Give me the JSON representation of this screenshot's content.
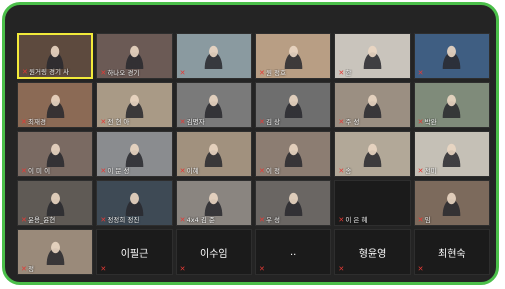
{
  "participants": [
    {
      "name": "원거링 경기 사",
      "video": true,
      "active": true,
      "bg": "#5d4a3e"
    },
    {
      "name": "하나오 경기",
      "video": true,
      "bg": "#6b5a55"
    },
    {
      "name": "",
      "video": true,
      "bg": "#8a9aa0"
    },
    {
      "name": "원 정호",
      "video": true,
      "bg": "#b89e84"
    },
    {
      "name": "한 ",
      "video": true,
      "bg": "#c9c4bc"
    },
    {
      "name": "",
      "video": true,
      "bg": "#3f5e82"
    },
    {
      "name": "최재경",
      "video": true,
      "bg": "#8b6a55"
    },
    {
      "name": "전 현 아",
      "video": true,
      "bg": "#a99a86"
    },
    {
      "name": "김명자",
      "video": true,
      "bg": "#7a7a7a"
    },
    {
      "name": "김 상 ",
      "video": true,
      "bg": "#6e6e6e"
    },
    {
      "name": "주 성",
      "video": true,
      "bg": "#9b8f82"
    },
    {
      "name": "박완 ",
      "video": true,
      "bg": "#7f8b7a"
    },
    {
      "name": "이 미 이",
      "video": true,
      "bg": "#7a6a62"
    },
    {
      "name": "이 문 성",
      "video": true,
      "bg": "#8a8c8f"
    },
    {
      "name": "이혜 ",
      "video": true,
      "bg": "#a1917e"
    },
    {
      "name": "이 정",
      "video": true,
      "bg": "#8c7d72"
    },
    {
      "name": "송 ",
      "video": true,
      "bg": "#b2a898"
    },
    {
      "name": "전미",
      "video": true,
      "bg": "#c5c0b6"
    },
    {
      "name": "윤용_윤현",
      "video": true,
      "bg": "#5f5a55"
    },
    {
      "name": "정정희 정진",
      "video": true,
      "bg": "#3e4a55"
    },
    {
      "name": "4x4 김 준",
      "video": true,
      "bg": "#8a8580"
    },
    {
      "name": "우 성 ",
      "video": true,
      "bg": "#6a6663"
    },
    {
      "name": "이 은 혜",
      "video": false,
      "bg": "#242424"
    },
    {
      "name": "임 ",
      "video": true,
      "bg": "#7c6a5c"
    },
    {
      "name": "정 ",
      "video": true,
      "bg": "#9a8a7a"
    },
    {
      "name": "",
      "video": false,
      "display": "이필근"
    },
    {
      "name": "",
      "video": false,
      "display": "이수임"
    },
    {
      "name": "",
      "video": false,
      "display": ".."
    },
    {
      "name": "",
      "video": false,
      "display": "형윤영"
    },
    {
      "name": "",
      "video": false,
      "display": "최현숙"
    }
  ]
}
